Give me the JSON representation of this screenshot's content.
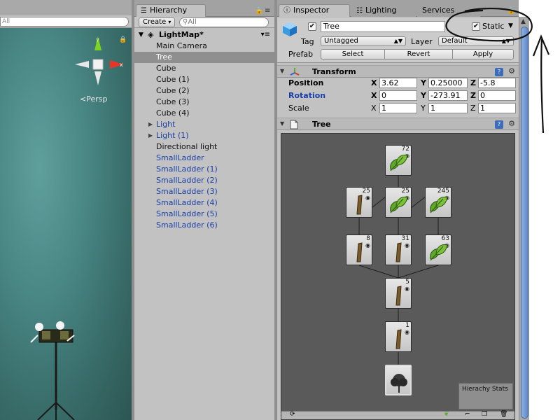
{
  "scene": {
    "search_placeholder": "All",
    "persp_label": "<Persp",
    "gizmo": {
      "y_label": "y",
      "x_label": "x"
    }
  },
  "hierarchy": {
    "tab_label": "Hierarchy",
    "create_label": "Create",
    "search_placeholder": "All",
    "scene_name": "LightMap*",
    "items": [
      {
        "label": "Main Camera",
        "kind": "normal",
        "expandable": false
      },
      {
        "label": "Tree",
        "kind": "selected",
        "expandable": false
      },
      {
        "label": "Cube",
        "kind": "normal",
        "expandable": false
      },
      {
        "label": "Cube (1)",
        "kind": "normal",
        "expandable": false
      },
      {
        "label": "Cube (2)",
        "kind": "normal",
        "expandable": false
      },
      {
        "label": "Cube (3)",
        "kind": "normal",
        "expandable": false
      },
      {
        "label": "Cube (4)",
        "kind": "normal",
        "expandable": false
      },
      {
        "label": "Light",
        "kind": "prefab",
        "expandable": true
      },
      {
        "label": "Light (1)",
        "kind": "prefab",
        "expandable": true
      },
      {
        "label": "Directional light",
        "kind": "normal",
        "expandable": false
      },
      {
        "label": "SmallLadder",
        "kind": "prefab",
        "expandable": false
      },
      {
        "label": "SmallLadder (1)",
        "kind": "prefab",
        "expandable": false
      },
      {
        "label": "SmallLadder (2)",
        "kind": "prefab",
        "expandable": false
      },
      {
        "label": "SmallLadder (3)",
        "kind": "prefab",
        "expandable": false
      },
      {
        "label": "SmallLadder (4)",
        "kind": "prefab",
        "expandable": false
      },
      {
        "label": "SmallLadder (5)",
        "kind": "prefab",
        "expandable": false
      },
      {
        "label": "SmallLadder (6)",
        "kind": "prefab",
        "expandable": false
      }
    ]
  },
  "inspector": {
    "tabs": {
      "inspector": "Inspector",
      "lighting": "Lighting",
      "services": "Services"
    },
    "object_name": "Tree",
    "active_checked": true,
    "static_label": "Static",
    "static_checked": true,
    "tag_label": "Tag",
    "tag_value": "Untagged",
    "layer_label": "Layer",
    "layer_value": "Default",
    "prefab_label": "Prefab",
    "prefab_buttons": {
      "select": "Select",
      "revert": "Revert",
      "apply": "Apply"
    },
    "transform": {
      "title": "Transform",
      "position_label": "Position",
      "rotation_label": "Rotation",
      "scale_label": "Scale",
      "axis_x": "X",
      "axis_y": "Y",
      "axis_z": "Z",
      "position": {
        "x": "3.62",
        "y": "0.25000",
        "z": "-5.8"
      },
      "rotation": {
        "x": "0",
        "y": "-273.91",
        "z": "0"
      },
      "scale": {
        "x": "1",
        "y": "1",
        "z": "1"
      }
    },
    "tree_component": {
      "title": "Tree",
      "nodes": [
        {
          "kind": "leaf",
          "count": "72"
        },
        {
          "kind": "branch",
          "count": "25"
        },
        {
          "kind": "leaf",
          "count": "25"
        },
        {
          "kind": "leaf",
          "count": "245"
        },
        {
          "kind": "branch",
          "count": "8"
        },
        {
          "kind": "branch",
          "count": "31"
        },
        {
          "kind": "leaf",
          "count": "63"
        },
        {
          "kind": "branch",
          "count": "5"
        },
        {
          "kind": "branch",
          "count": "1"
        },
        {
          "kind": "root",
          "count": ""
        }
      ],
      "stats_label": "Hierachy Stats"
    }
  },
  "colors": {
    "prefab_text": "#1b3fa8",
    "leaf_green": "#5fa82a",
    "branch_brown": "#7a5a2a",
    "scene_bg": "#4a8886",
    "selection": "#8f8f8f"
  }
}
